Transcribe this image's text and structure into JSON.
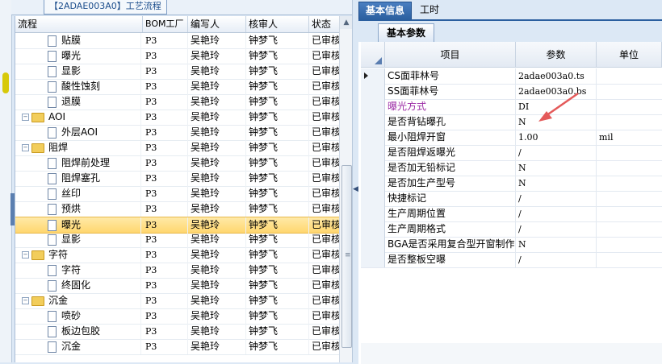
{
  "left_panel": {
    "tab_title": "【2ADAE003A0】工艺流程",
    "columns": [
      "流程",
      "BOM工厂",
      "编写人",
      "核审人",
      "状态"
    ],
    "rows": [
      {
        "name": "贴膜",
        "level": 2,
        "kind": "doc",
        "bom": "P3",
        "writer": "吴艳玲",
        "reviewer": "钟梦飞",
        "status": "已审核"
      },
      {
        "name": "曝光",
        "level": 2,
        "kind": "doc",
        "bom": "P3",
        "writer": "吴艳玲",
        "reviewer": "钟梦飞",
        "status": "已审核"
      },
      {
        "name": "显影",
        "level": 2,
        "kind": "doc",
        "bom": "P3",
        "writer": "吴艳玲",
        "reviewer": "钟梦飞",
        "status": "已审核"
      },
      {
        "name": "酸性蚀刻",
        "level": 2,
        "kind": "doc",
        "bom": "P3",
        "writer": "吴艳玲",
        "reviewer": "钟梦飞",
        "status": "已审核"
      },
      {
        "name": "退膜",
        "level": 2,
        "kind": "doc",
        "bom": "P3",
        "writer": "吴艳玲",
        "reviewer": "钟梦飞",
        "status": "已审核"
      },
      {
        "name": "AOI",
        "level": 1,
        "kind": "folder",
        "bom": "P3",
        "writer": "吴艳玲",
        "reviewer": "钟梦飞",
        "status": "已审核"
      },
      {
        "name": "外层AOI",
        "level": 2,
        "kind": "doc",
        "bom": "P3",
        "writer": "吴艳玲",
        "reviewer": "钟梦飞",
        "status": "已审核"
      },
      {
        "name": "阻焊",
        "level": 1,
        "kind": "folder",
        "bom": "P3",
        "writer": "吴艳玲",
        "reviewer": "钟梦飞",
        "status": "已审核"
      },
      {
        "name": "阻焊前处理",
        "level": 2,
        "kind": "doc",
        "bom": "P3",
        "writer": "吴艳玲",
        "reviewer": "钟梦飞",
        "status": "已审核"
      },
      {
        "name": "阻焊塞孔",
        "level": 2,
        "kind": "doc",
        "bom": "P3",
        "writer": "吴艳玲",
        "reviewer": "钟梦飞",
        "status": "已审核"
      },
      {
        "name": "丝印",
        "level": 2,
        "kind": "doc",
        "bom": "P3",
        "writer": "吴艳玲",
        "reviewer": "钟梦飞",
        "status": "已审核"
      },
      {
        "name": "预烘",
        "level": 2,
        "kind": "doc",
        "bom": "P3",
        "writer": "吴艳玲",
        "reviewer": "钟梦飞",
        "status": "已审核"
      },
      {
        "name": "曝光",
        "level": 2,
        "kind": "doc",
        "bom": "P3",
        "writer": "吴艳玲",
        "reviewer": "钟梦飞",
        "status": "已审核",
        "selected": true
      },
      {
        "name": "显影",
        "level": 2,
        "kind": "doc",
        "bom": "P3",
        "writer": "吴艳玲",
        "reviewer": "钟梦飞",
        "status": "已审核"
      },
      {
        "name": "字符",
        "level": 1,
        "kind": "folder",
        "bom": "P3",
        "writer": "吴艳玲",
        "reviewer": "钟梦飞",
        "status": "已审核"
      },
      {
        "name": "字符",
        "level": 2,
        "kind": "doc",
        "bom": "P3",
        "writer": "吴艳玲",
        "reviewer": "钟梦飞",
        "status": "已审核"
      },
      {
        "name": "终固化",
        "level": 2,
        "kind": "doc",
        "bom": "P3",
        "writer": "吴艳玲",
        "reviewer": "钟梦飞",
        "status": "已审核"
      },
      {
        "name": "沉金",
        "level": 1,
        "kind": "folder",
        "bom": "P3",
        "writer": "吴艳玲",
        "reviewer": "钟梦飞",
        "status": "已审核"
      },
      {
        "name": "喷砂",
        "level": 2,
        "kind": "doc",
        "bom": "P3",
        "writer": "吴艳玲",
        "reviewer": "钟梦飞",
        "status": "已审核"
      },
      {
        "name": "板边包胶",
        "level": 2,
        "kind": "doc",
        "bom": "P3",
        "writer": "吴艳玲",
        "reviewer": "钟梦飞",
        "status": "已审核"
      },
      {
        "name": "沉金",
        "level": 2,
        "kind": "doc",
        "bom": "P3",
        "writer": "吴艳玲",
        "reviewer": "钟梦飞",
        "status": "已审核"
      }
    ]
  },
  "right_panel": {
    "tabs": [
      "基本信息",
      "工时"
    ],
    "sub_tab": "基本参数",
    "columns": [
      "项目",
      "参数",
      "单位"
    ],
    "rows": [
      {
        "item": "CS面菲林号",
        "param": "2adae003a0.ts",
        "unit": "",
        "current": true
      },
      {
        "item": "SS面菲林号",
        "param": "2adae003a0.bs",
        "unit": ""
      },
      {
        "item": "曝光方式",
        "param": "DI",
        "unit": "",
        "highlight": true
      },
      {
        "item": "是否背钻曝孔",
        "param": "N",
        "unit": ""
      },
      {
        "item": "最小阻焊开窗",
        "param": "1.00",
        "unit": "mil"
      },
      {
        "item": "是否阻焊返曝光",
        "param": "/",
        "unit": ""
      },
      {
        "item": "是否加无铅标记",
        "param": "N",
        "unit": ""
      },
      {
        "item": "是否加生产型号",
        "param": "N",
        "unit": ""
      },
      {
        "item": "快捷标记",
        "param": "/",
        "unit": ""
      },
      {
        "item": "生产周期位置",
        "param": "/",
        "unit": ""
      },
      {
        "item": "生产周期格式",
        "param": "/",
        "unit": ""
      },
      {
        "item": "BGA是否采用复合型开窗制作",
        "param": "N",
        "unit": ""
      },
      {
        "item": "是否整板空曝",
        "param": "/",
        "unit": ""
      }
    ]
  },
  "colors": {
    "highlight_text": "#9b2aa5",
    "selection": "#ffd66e",
    "tab_active": "#2b5f9f",
    "arrow": "#e45a5a"
  }
}
